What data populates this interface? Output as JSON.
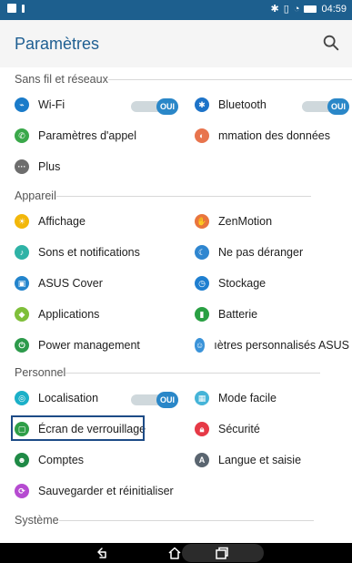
{
  "status_bar": {
    "time": "04:59",
    "icons": [
      "screenshot-icon",
      "notification-icon",
      "bluetooth-icon",
      "vibrate-icon",
      "wifi-icon",
      "battery-icon"
    ]
  },
  "app_bar": {
    "title": "Paramètres",
    "search_icon": "search-icon"
  },
  "sections": {
    "wireless": {
      "title": "Sans fil et réseaux",
      "wifi": {
        "label": "Wi-Fi",
        "toggle": "OUI",
        "color": "#1a7bc9"
      },
      "bluetooth": {
        "label": "Bluetooth",
        "toggle": "OUI",
        "color": "#1d73c8"
      },
      "calls": {
        "label": "Paramètres d'appel",
        "color": "#3aa84a"
      },
      "data": {
        "label": "mmation des données",
        "color": "#e8744d"
      },
      "more": {
        "label": "Plus",
        "color": "#6d6d6d"
      }
    },
    "device": {
      "title": "Appareil",
      "display": {
        "label": "Affichage",
        "color": "#f2b70a"
      },
      "zenmotion": {
        "label": "ZenMotion",
        "color": "#e9753e"
      },
      "sounds": {
        "label": "Sons et notifications",
        "color": "#2fb3a6"
      },
      "dnd": {
        "label": "Ne pas déranger",
        "color": "#2f86d0"
      },
      "cover": {
        "label": "ASUS Cover",
        "color": "#2384cc"
      },
      "storage": {
        "label": "Stockage",
        "color": "#1f7fd0"
      },
      "apps": {
        "label": "Applications",
        "color": "#7fbf3a"
      },
      "battery": {
        "label": "Batterie",
        "color": "#29a043"
      },
      "power": {
        "label": "Power management",
        "color": "#2d9a4b"
      },
      "custom": {
        "label": "ıètres personnalisés ASUS",
        "color": "#3a93d9"
      }
    },
    "personal": {
      "title": "Personnel",
      "location": {
        "label": "Localisation",
        "toggle": "OUI",
        "color": "#1bb0c8"
      },
      "easy": {
        "label": "Mode facile",
        "color": "#45b4d8"
      },
      "lock": {
        "label": "Écran de verrouillage",
        "color": "#2e9e47"
      },
      "security": {
        "label": "Sécurité",
        "color": "#e63946"
      },
      "accounts": {
        "label": "Comptes",
        "color": "#1f8a46"
      },
      "language": {
        "label": "Langue et saisie",
        "color": "#5a6570"
      },
      "backup": {
        "label": "Sauvegarder et réinitialiser",
        "color": "#b64bd1"
      }
    },
    "system": {
      "title": "Système"
    }
  },
  "nav_bar": {
    "back_icon": "back-icon",
    "home_icon": "home-icon",
    "recents_icon": "recents-icon"
  }
}
